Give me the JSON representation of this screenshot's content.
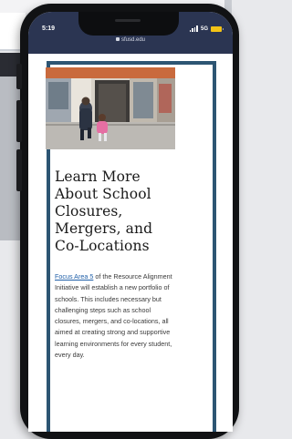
{
  "status_bar": {
    "time": "5:19",
    "network": "5G",
    "url": "sfusd.edu"
  },
  "article": {
    "title": "Learn More About School Closures, Mergers, and Co-Locations",
    "link_text": "Focus Area 5",
    "body": " of the Resource Alignment Initiative will establish a new portfolio of schools. This includes necessary but challenging steps such as school closures, mergers, and co-locations, all aimed at creating strong and supportive learning environments for every student, every day."
  },
  "colors": {
    "status_bar": "#2b3552",
    "frame_border": "#2d5573",
    "link": "#1f5fa8",
    "battery": "#f3c316"
  }
}
